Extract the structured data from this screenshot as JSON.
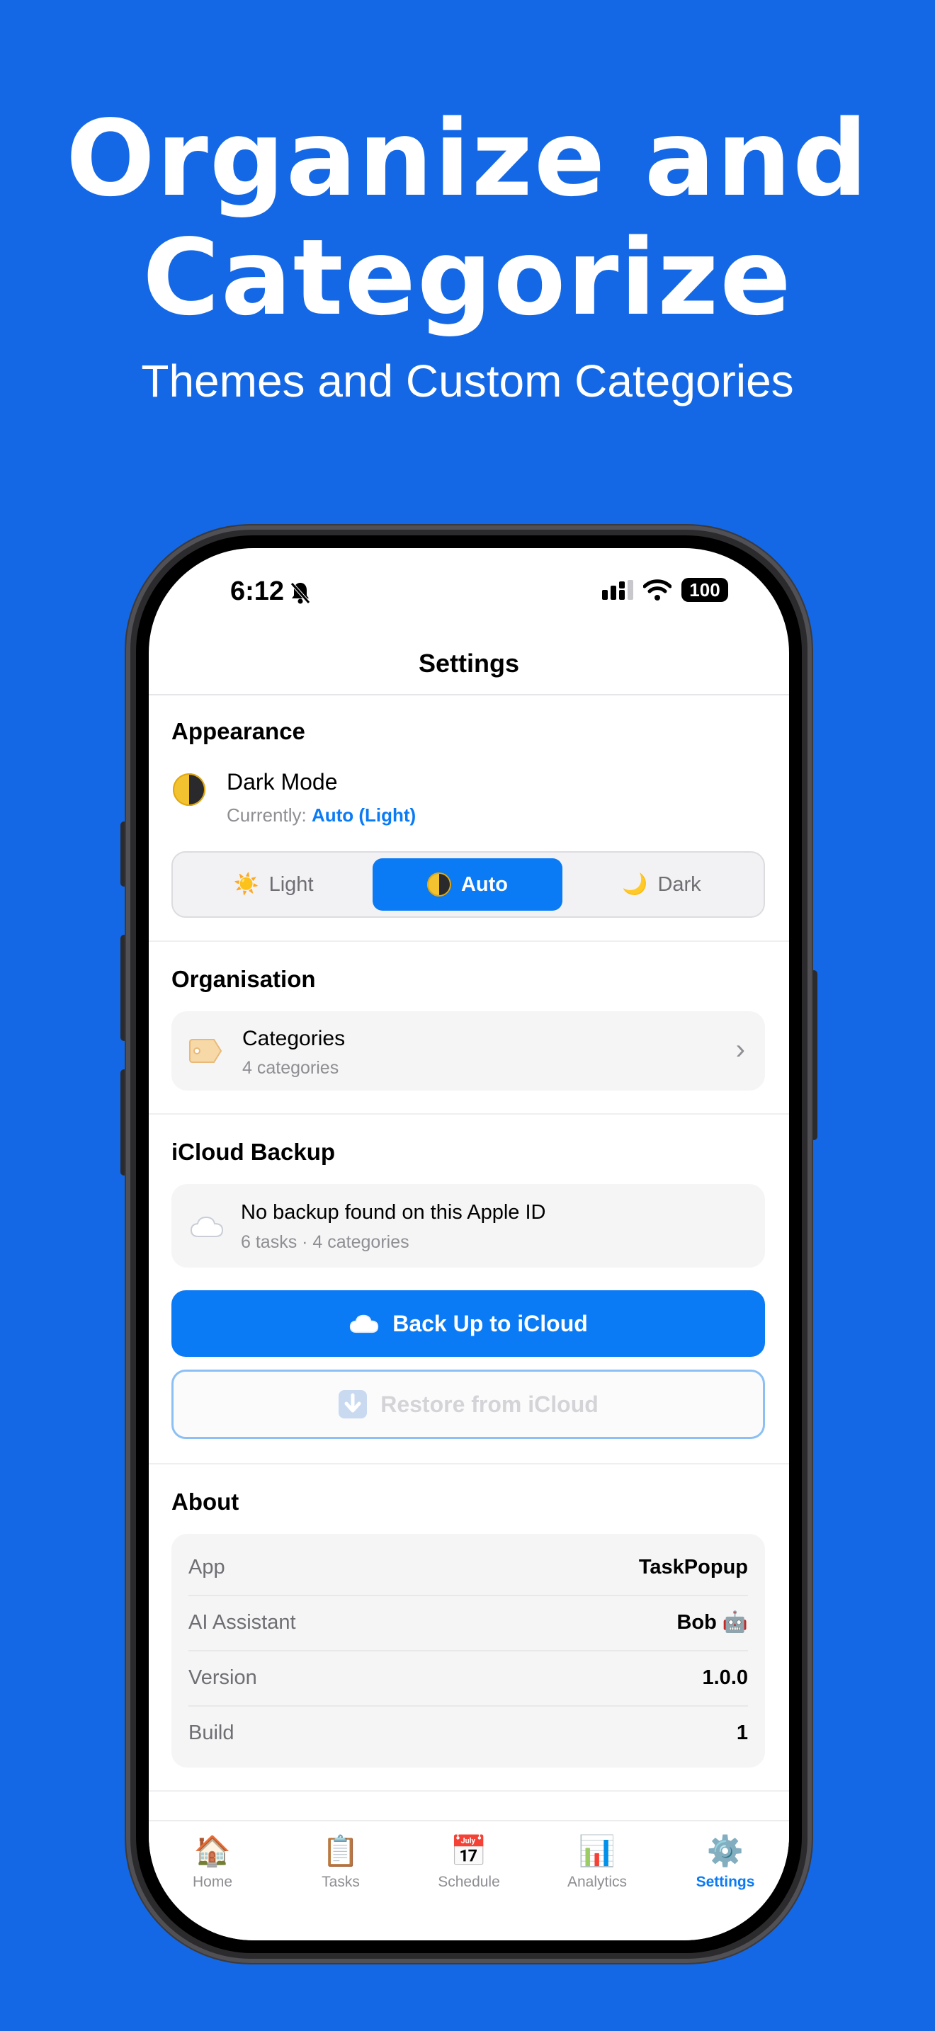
{
  "hero": {
    "title_line1": "Organize and",
    "title_line2": "Categorize",
    "subtitle": "Themes and Custom Categories"
  },
  "status_bar": {
    "time": "6:12",
    "battery": "100"
  },
  "nav": {
    "title": "Settings"
  },
  "appearance": {
    "section_title": "Appearance",
    "dark_mode_label": "Dark Mode",
    "currently_prefix": "Currently:",
    "currently_value": "Auto (Light)",
    "options": [
      {
        "icon": "☀️",
        "label": "Light"
      },
      {
        "icon": "🌓",
        "label": "Auto"
      },
      {
        "icon": "🌙",
        "label": "Dark"
      }
    ],
    "selected": "Auto"
  },
  "organisation": {
    "section_title": "Organisation",
    "categories_label": "Categories",
    "categories_count": "4 categories",
    "chevron": "›"
  },
  "icloud": {
    "section_title": "iCloud Backup",
    "status_title": "No backup found on this Apple ID",
    "status_detail": "6 tasks · 4 categories",
    "backup_button": "Back Up to iCloud",
    "restore_button": "Restore from iCloud"
  },
  "about": {
    "section_title": "About",
    "rows": [
      {
        "key": "App",
        "value": "TaskPopup"
      },
      {
        "key": "AI Assistant",
        "value": "Bob 🤖"
      },
      {
        "key": "Version",
        "value": "1.0.0"
      },
      {
        "key": "Build",
        "value": "1"
      }
    ]
  },
  "tabbar": {
    "tabs": [
      {
        "icon": "🏠",
        "label": "Home"
      },
      {
        "icon": "📋",
        "label": "Tasks"
      },
      {
        "icon": "📅",
        "label": "Schedule"
      },
      {
        "icon": "📊",
        "label": "Analytics"
      },
      {
        "icon": "⚙️",
        "label": "Settings"
      }
    ],
    "active": "Settings"
  },
  "colors": {
    "background": "#1468E6",
    "accent": "#0A7AF5"
  }
}
